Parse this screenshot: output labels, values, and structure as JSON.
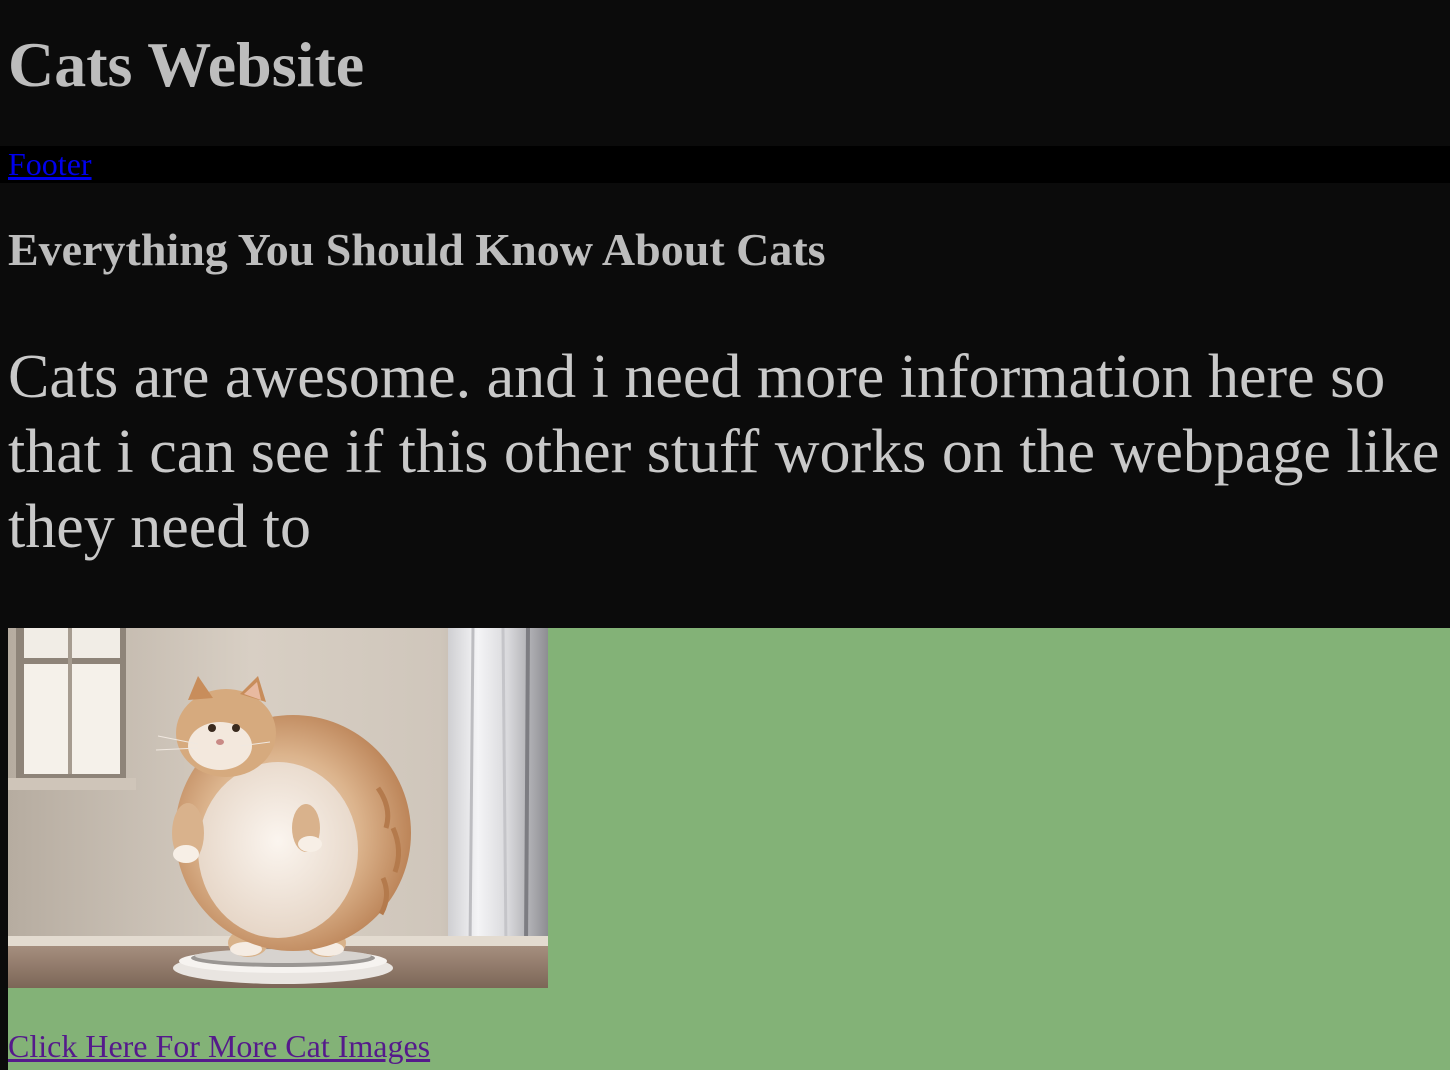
{
  "header": {
    "title": "Cats Website"
  },
  "nav": {
    "footer_link": "Footer"
  },
  "main": {
    "heading": "Everything You Should Know About Cats",
    "paragraph": "Cats are awesome. and i need more information here so that i can see if this other stuff works on the webpage like they need to"
  },
  "gallery": {
    "image_subject": "chubby orange cat standing on a scale",
    "more_images_link": "Click Here For More Cat Images"
  },
  "colors": {
    "page_background": "#0b0b0b",
    "nav_background": "#000000",
    "text": "#bdbdbd",
    "link": "#0000ee",
    "visited_link": "#551a8b",
    "gallery_background": "#83b277"
  }
}
